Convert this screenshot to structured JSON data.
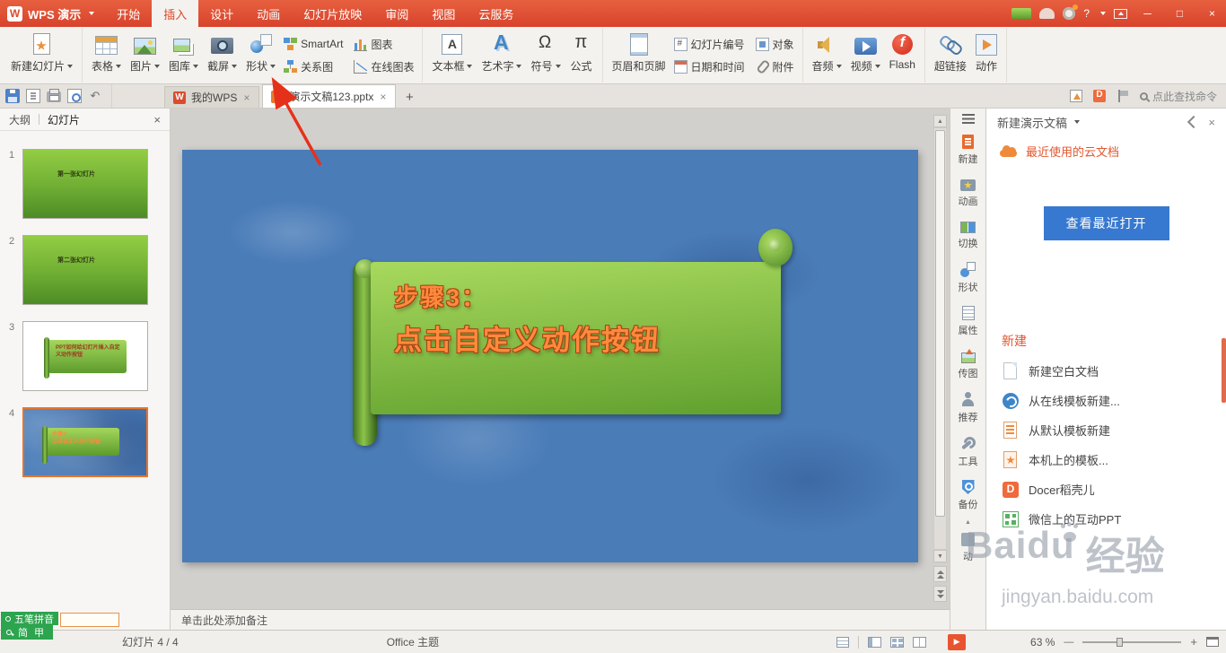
{
  "icons": {
    "close": "×",
    "plus": "+",
    "minimize": "─",
    "maximize": "□",
    "help": "?",
    "up_arrow": "▲",
    "down_arrow": "▼",
    "play": "▶",
    "minus": "—",
    "undo": "↶"
  },
  "titlebar": {
    "app_name": "WPS 演示",
    "menus": [
      "开始",
      "插入",
      "设计",
      "动画",
      "幻灯片放映",
      "审阅",
      "视图",
      "云服务"
    ]
  },
  "ribbon": {
    "new_slide": "新建幻灯片",
    "table": "表格",
    "picture": "图片",
    "gallery": "图库",
    "screenshot": "截屏",
    "shape": "形状",
    "smartart": "SmartArt",
    "chart": "图表",
    "relation_chart": "关系图",
    "online_chart": "在线图表",
    "textbox": "文本框",
    "wordart": "艺术字",
    "symbol": "符号",
    "formula": "公式",
    "header_footer": "页眉和页脚",
    "slide_number": "幻灯片编号",
    "date_time": "日期和时间",
    "object": "对象",
    "attachment": "附件",
    "audio": "音频",
    "video": "视频",
    "flash": "Flash",
    "hyperlink": "超链接",
    "action": "动作"
  },
  "tabbar": {
    "tab_home": "我的WPS",
    "tab_doc": "演示文稿123.pptx",
    "search_hint": "点此查找命令"
  },
  "left_panel": {
    "outline": "大纲",
    "slides": "幻灯片",
    "thumbs": [
      {
        "num": "1",
        "text": "第一张幻灯片"
      },
      {
        "num": "2",
        "text": "第二张幻灯片"
      },
      {
        "num": "3",
        "text": "PPT如何给幻灯片插入自定义动作按钮"
      },
      {
        "num": "4",
        "line1": "步骤3：",
        "line2": "点击自定义动作按钮"
      }
    ]
  },
  "slide": {
    "line1": "步骤3：",
    "line2": "点击自定义动作按钮"
  },
  "notes": {
    "placeholder": "单击此处添加备注"
  },
  "right_bar": {
    "items": [
      "新建",
      "动画",
      "切换",
      "形状",
      "属性",
      "传图",
      "推荐",
      "工具",
      "备份",
      "动"
    ]
  },
  "task_pane": {
    "title": "新建演示文稿",
    "recent_cloud": "最近使用的云文档",
    "view_recent": "查看最近打开",
    "new_label": "新建",
    "items": [
      "新建空白文档",
      "从在线模板新建...",
      "从默认模板新建",
      "本机上的模板...",
      "Docer稻壳儿",
      "微信上的互动PPT"
    ]
  },
  "watermark": {
    "brand": "Baidu",
    "cn": "经验",
    "url": "jingyan.baidu.com"
  },
  "ime": {
    "name": "五笔拼音",
    "m1": "简",
    "m2": "甲"
  },
  "status": {
    "slide_counter": "幻灯片 4 / 4",
    "theme": "Office 主题",
    "zoom": "63 %"
  },
  "colors": {
    "titlebar": "#dd4a2e",
    "accent_blue": "#3779d0",
    "slide_blue": "#4a7cb8",
    "banner_green": "#79b63c",
    "banner_text": "#ff8a3c",
    "selection": "#e8742c",
    "ime_green": "#2da44e"
  }
}
